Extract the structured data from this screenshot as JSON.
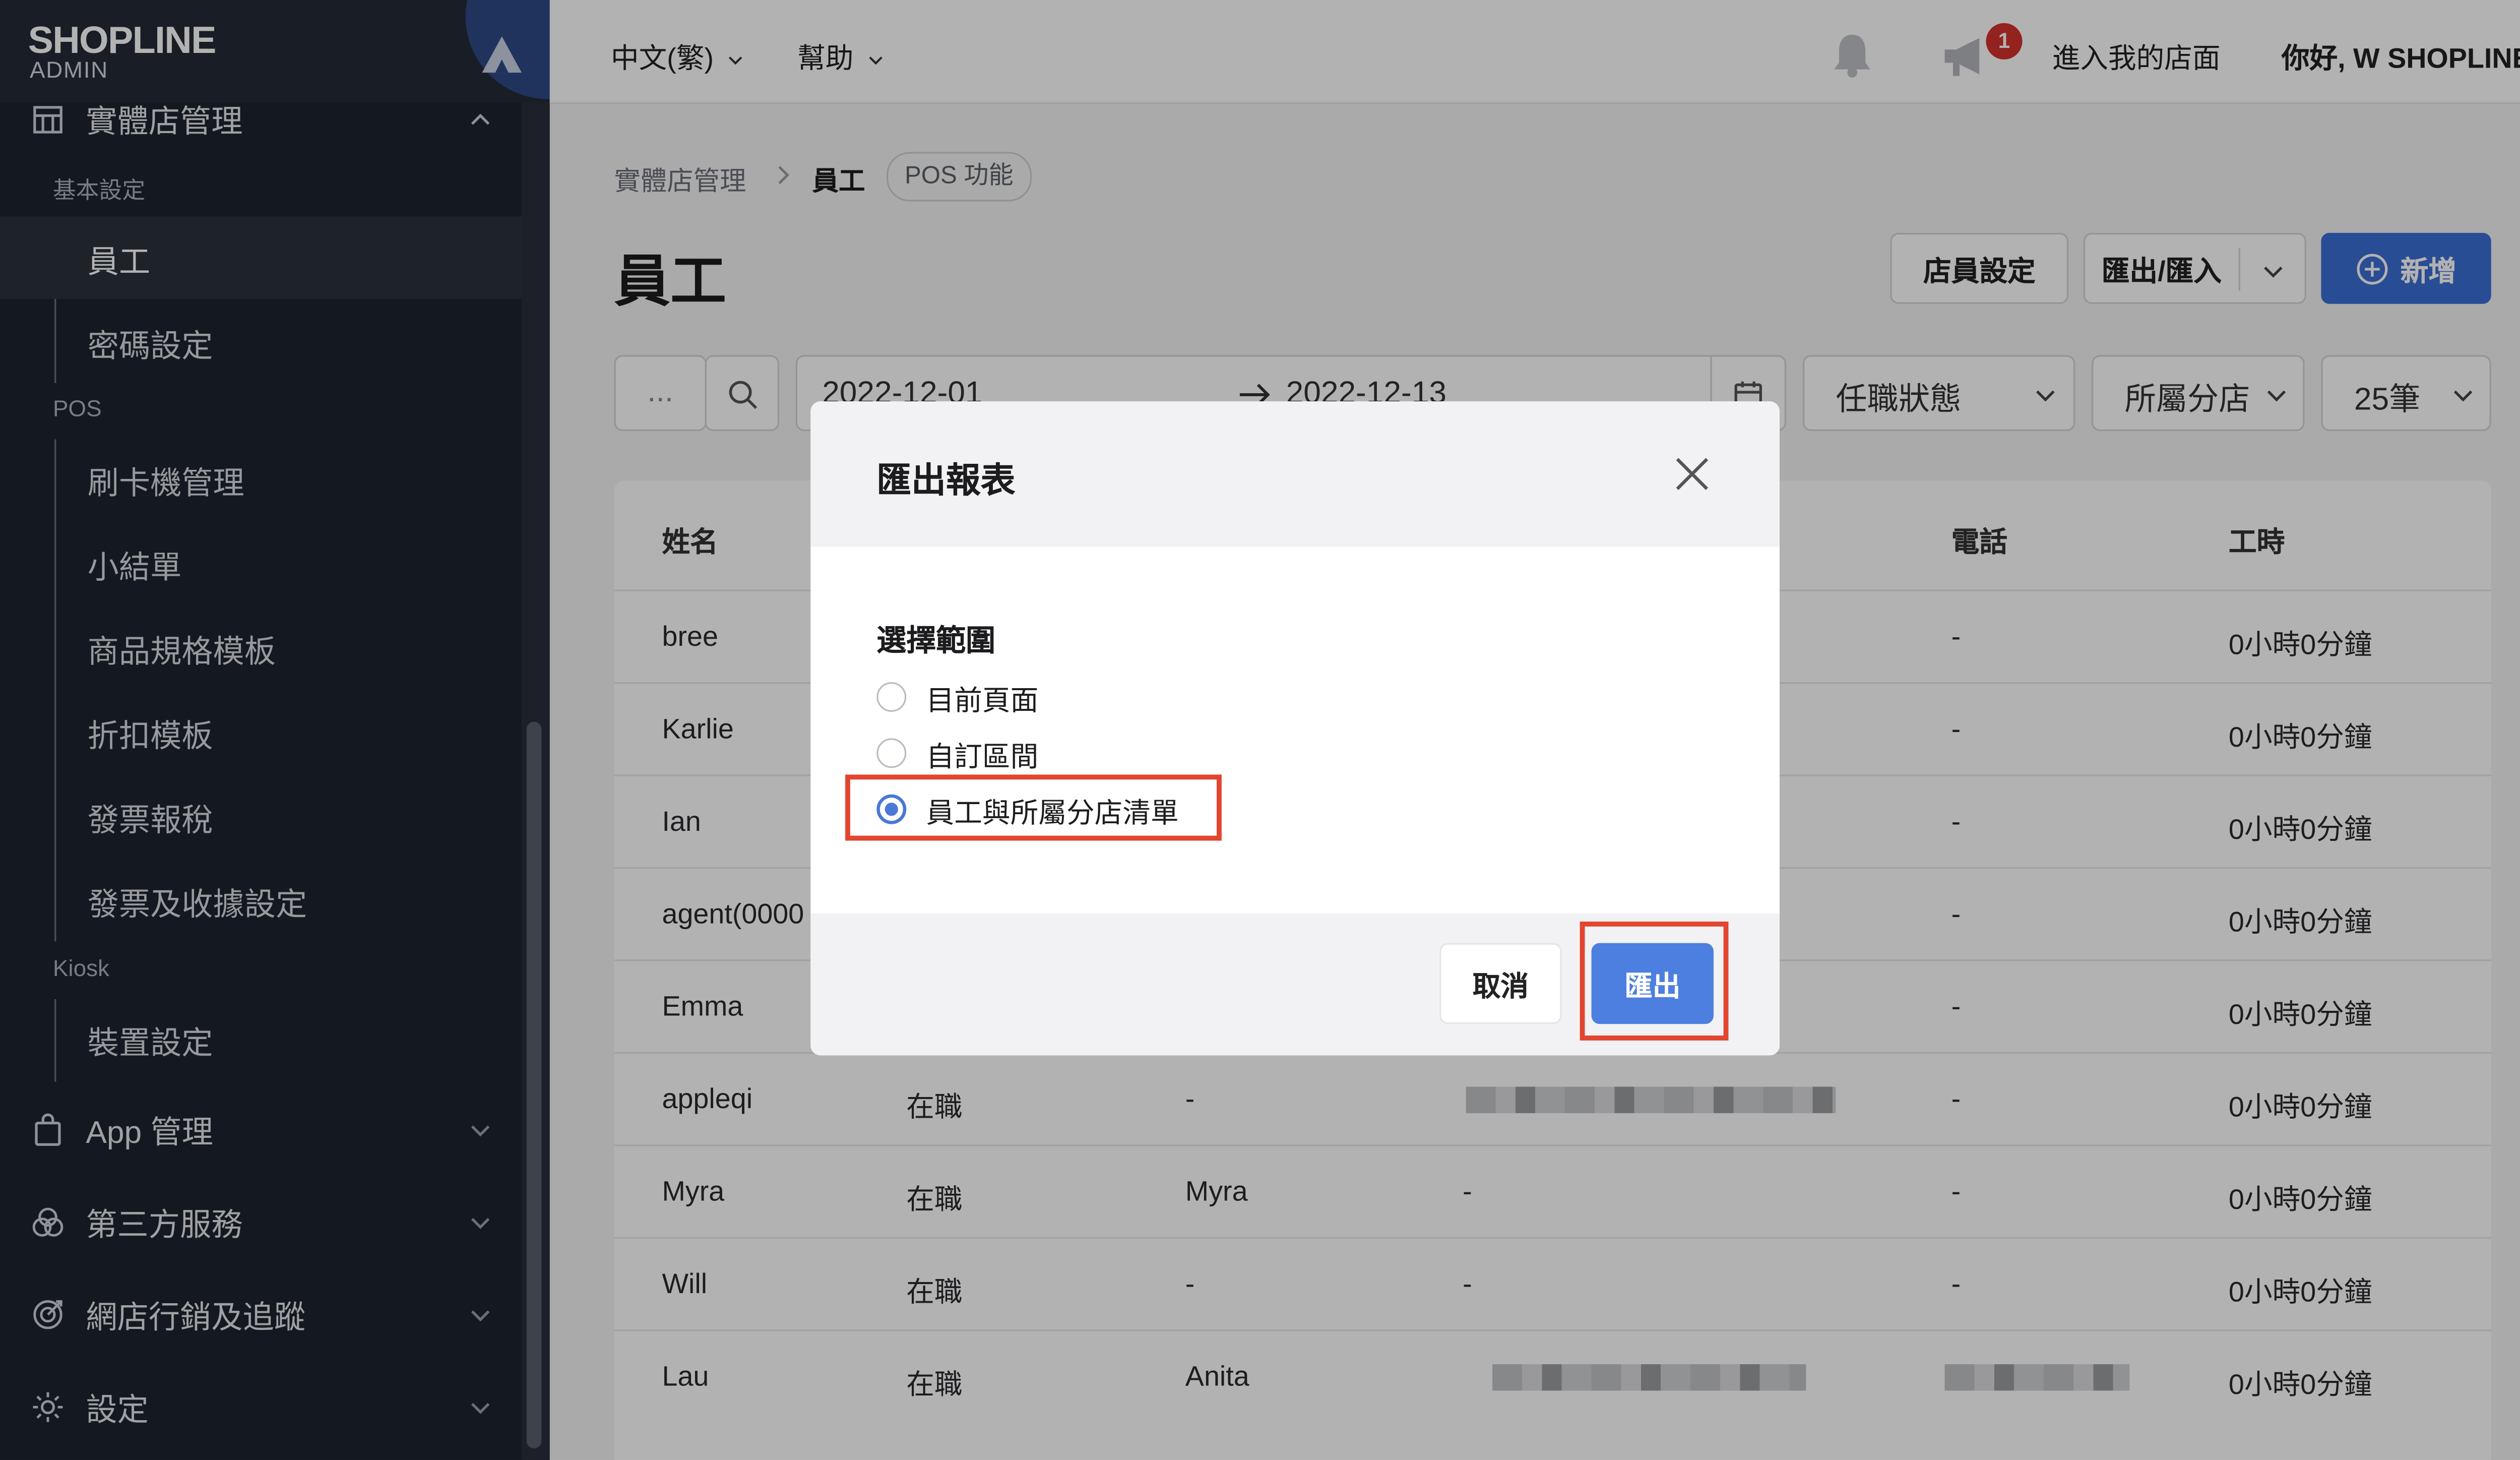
{
  "brand": {
    "name": "SHOPLINE",
    "sub": "ADMIN"
  },
  "topbar": {
    "language": "中文(繁)",
    "help": "幫助",
    "notification_count": "1",
    "visit_store": "進入我的店面",
    "greeting": "你好, W SHOPLINE"
  },
  "sidebar": {
    "section_title": "實體店管理",
    "groups": [
      {
        "title": "基本設定",
        "items": [
          "員工",
          "密碼設定"
        ]
      },
      {
        "title": "POS",
        "items": [
          "刷卡機管理",
          "小結單",
          "商品規格模板",
          "折扣模板",
          "發票報稅",
          "發票及收據設定"
        ]
      },
      {
        "title": "Kiosk",
        "items": [
          "裝置設定"
        ]
      }
    ],
    "top_level": [
      "App 管理",
      "第三方服務",
      "網店行銷及追蹤",
      "設定"
    ]
  },
  "breadcrumb": {
    "parent": "實體店管理",
    "current": "員工",
    "badge": "POS 功能"
  },
  "page": {
    "title": "員工",
    "buttons": {
      "staff_settings": "店員設定",
      "export_import": "匯出/匯入",
      "add": "新增"
    }
  },
  "filters": {
    "search_placeholder": "...",
    "date_start": "2022-12-01",
    "date_end": "2022-12-13",
    "status": "任職狀態",
    "branch": "所屬分店",
    "page_size": "25筆"
  },
  "table": {
    "headers": [
      "姓名",
      "電話",
      "工時"
    ],
    "rows": [
      {
        "name": "bree",
        "status": "",
        "nickname": "",
        "contact": "",
        "phone": "-",
        "hours": "0小時0分鐘",
        "contact_blurred": false,
        "phone_blurred": false
      },
      {
        "name": "Karlie",
        "status": "",
        "nickname": "",
        "contact": "",
        "phone": "-",
        "hours": "0小時0分鐘",
        "contact_blurred": false,
        "phone_blurred": false
      },
      {
        "name": "Ian",
        "status": "",
        "nickname": "",
        "contact": "",
        "phone": "-",
        "hours": "0小時0分鐘",
        "contact_blurred": false,
        "phone_blurred": false
      },
      {
        "name": "agent(0000",
        "status": "",
        "nickname": "",
        "contact": "",
        "phone": "-",
        "hours": "0小時0分鐘",
        "contact_blurred": false,
        "phone_blurred": false
      },
      {
        "name": "Emma",
        "status": "",
        "nickname": "",
        "contact": "",
        "phone": "-",
        "hours": "0小時0分鐘",
        "contact_blurred": false,
        "phone_blurred": false
      },
      {
        "name": "appleqi",
        "status": "在職",
        "nickname": "-",
        "contact": "",
        "phone": "-",
        "hours": "0小時0分鐘",
        "contact_blurred": true,
        "phone_blurred": false
      },
      {
        "name": "Myra",
        "status": "在職",
        "nickname": "Myra",
        "contact": "-",
        "phone": "-",
        "hours": "0小時0分鐘",
        "contact_blurred": false,
        "phone_blurred": false
      },
      {
        "name": "Will",
        "status": "在職",
        "nickname": "-",
        "contact": "-",
        "phone": "-",
        "hours": "0小時0分鐘",
        "contact_blurred": false,
        "phone_blurred": false
      },
      {
        "name": "Lau",
        "status": "在職",
        "nickname": "Anita",
        "contact": "",
        "phone": "",
        "hours": "0小時0分鐘",
        "contact_blurred": true,
        "phone_blurred": true
      }
    ]
  },
  "modal": {
    "title": "匯出報表",
    "range_label": "選擇範圍",
    "options": [
      "目前頁面",
      "自訂區間",
      "員工與所屬分店清單"
    ],
    "selected_option": "員工與所屬分店清單",
    "cancel": "取消",
    "confirm": "匯出"
  },
  "colors": {
    "primary": "#3b6fd4",
    "sidebar": "#1e2430",
    "highlight": "#e3452e"
  }
}
